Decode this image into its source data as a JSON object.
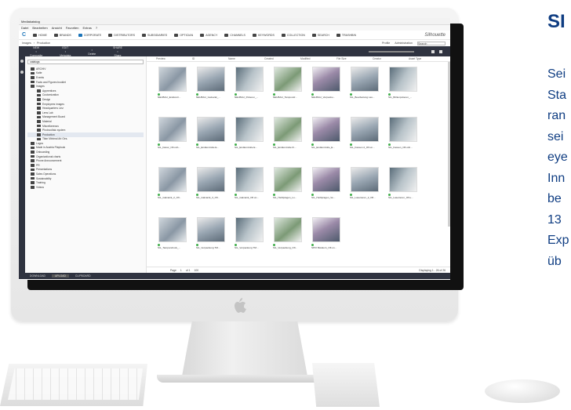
{
  "side": {
    "title": "SI",
    "lines": [
      "Sei",
      "Sta",
      "ran",
      "sei",
      "eye",
      "Inn",
      "be",
      "13",
      "Exp",
      "üb"
    ]
  },
  "app": {
    "window_title": "Mediakatalog",
    "menu": [
      "Datei",
      "Bearbeiten",
      "Ansicht",
      "Favoriten",
      "Extras",
      "?"
    ],
    "nav": [
      "HOME",
      "BRANDS",
      "CORPORATE",
      "DISTRIBUTORS",
      "SUBSIDIARIES",
      "OPTICIAN",
      "AGENCY",
      "CHANNELS",
      "KEYWORDS",
      "COLLECTION",
      "SEARCH",
      "TRASHBIN"
    ],
    "nav_active": "CORPORATE",
    "brand": "Silhouette",
    "breadcrumb": [
      "Images",
      "Production"
    ],
    "profile": "Profile",
    "admin": "Administration",
    "search_placeholder": "Search",
    "toolbar_groups": [
      {
        "title": "NEW",
        "label": "Composite"
      },
      {
        "title": "EDIT",
        "label": "Metadata"
      },
      {
        "title": "",
        "label": "Delete"
      },
      {
        "title": "SHARE",
        "label": "Share"
      }
    ],
    "tree_search": "catalogs",
    "tree": [
      "ARCHIV",
      "Kalte",
      "Events",
      "Facts and Figures booklet",
      "Images",
      "Apprentices",
      "Customization",
      "Design",
      "Employees images",
      "Headquarters Linz",
      "Lens Lab",
      "Management Board",
      "Material",
      "Miscellaneous",
      "Photovoltaic system",
      "Production",
      "Titan Minimal Art Ges.",
      "Logos",
      "Made in Austria Playbook",
      "Onboarding",
      "Organizational charts",
      "Phone Announcement",
      "PR",
      "Presentations",
      "Sales Operations",
      "Sustainability",
      "Training",
      "Videos"
    ],
    "tree_selected": "Production",
    "columns": [
      "Preview",
      "ID",
      "Name",
      "Created",
      "Modified",
      "File Size",
      "Creator",
      "Asset Type"
    ],
    "assets": [
      "NEUBAU_Endkontr...",
      "NEUBAU_Galvanik_...",
      "NEUBAU_Polieren_...",
      "NEUBAU_Tampondr...",
      "NEUBAU_Verpacku...",
      "SIL_Bearbeitung Las...",
      "SIL_Brillenpolieren_...",
      "SIL_Dekor_Ofl.unh...",
      "SIL_Endkontrolle E...",
      "SIL_Endkontrolle E...",
      "SIL_Endkontrolle Fl...",
      "SIL_Endkontrolle_E...",
      "SIL_Fassen 2_Ofl.un...",
      "SIL_Fassen_Ofl.unh...",
      "SIL_Galvanik_2_Ofl...",
      "SIL_Galvanik_3_Ofl...",
      "SIL_Galvanik_Ofl.un...",
      "SIL_Heißpragen_Lo...",
      "SIL_Heißpragen_Ve...",
      "SIL_Laserieren_2_Ofl...",
      "SIL_Laserieren_Ofl.u...",
      "SIL_Tampondruck_...",
      "SIL_Verpackung TM...",
      "SIL_Verpackung TM...",
      "SIL_Verpackung_Ofl...",
      "SPIX Bändern_Ofl.un..."
    ],
    "pager": {
      "page_label": "Page",
      "page": "1",
      "of": "of 1",
      "per_page": "100",
      "displaying": "Displaying 1 - 26 of 26"
    },
    "bottom": [
      "DOWNLOAD",
      "UPLOAD",
      "CLIPBOARD"
    ]
  }
}
